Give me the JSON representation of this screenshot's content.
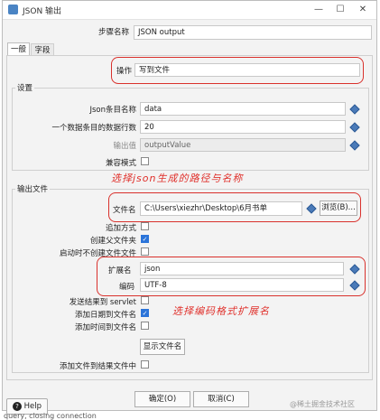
{
  "window": {
    "title": "JSON 输出",
    "minimize": "—",
    "maximize": "☐",
    "close": "✕"
  },
  "step": {
    "label": "步骤名称",
    "value": "JSON output"
  },
  "tabs": [
    "一般",
    "字段"
  ],
  "operation": {
    "label": "操作",
    "value": "写到文件"
  },
  "settings": {
    "title": "设置",
    "json_block_name": {
      "label": "Json条目名称",
      "value": "data"
    },
    "rows_per_block": {
      "label": "一个数据条目的数据行数",
      "value": "20"
    },
    "output_value": {
      "label": "输出值",
      "value": "outputValue"
    },
    "compat_mode": {
      "label": "兼容模式"
    }
  },
  "output_file": {
    "title": "输出文件",
    "filename": {
      "label": "文件名",
      "value": "C:\\Users\\xiezhr\\Desktop\\6月书单"
    },
    "browse_label": "浏览(B)...",
    "append": {
      "label": "追加方式",
      "checked": false
    },
    "create_parent": {
      "label": "创建父文件夹",
      "checked": true
    },
    "no_create_on_start": {
      "label": "启动时不创建文件文件",
      "checked": false
    },
    "extension": {
      "label": "扩展名",
      "value": "json"
    },
    "encoding": {
      "label": "编码",
      "value": "UTF-8"
    },
    "send_to_servlet": {
      "label": "发送结果到 servlet",
      "checked": false
    },
    "add_date": {
      "label": "添加日期到文件名",
      "checked": true
    },
    "add_time": {
      "label": "添加时间到文件名",
      "checked": false
    },
    "show_filenames_label": "显示文件名",
    "add_to_result": {
      "label": "添加文件到结果文件中",
      "checked": false
    }
  },
  "annotations": {
    "path_note": "选择json生成的路径与名称",
    "encoding_note": "选择编码格式扩展名"
  },
  "footer": {
    "help_label": "Help",
    "ok_label": "确定(O)",
    "cancel_label": "取消(C)",
    "watermark": "@稀土掘金技术社区",
    "bottom_text": "query, closing connection"
  },
  "colors": {
    "annotation_red": "#d9312c",
    "checkbox_blue": "#2b74d9",
    "variable_icon": "#4a7ab8"
  }
}
